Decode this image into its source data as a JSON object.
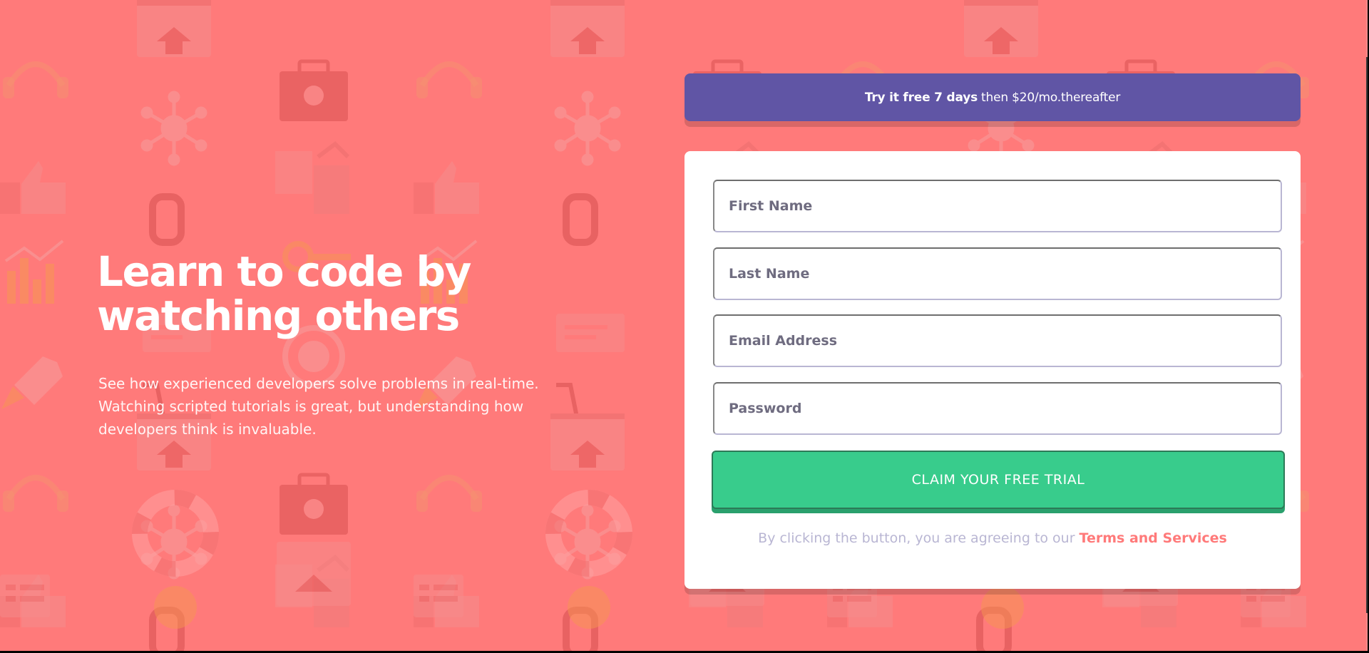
{
  "theme": {
    "background": "#ff7a7a",
    "offer_bg": "#6055a5",
    "cta_bg": "#38cc8c",
    "accent_link": "#ff7a7a",
    "muted_text": "#b9b6d3"
  },
  "hero": {
    "title": "Learn to code by watching others",
    "description": "See how experienced developers solve problems in real-time. Watching scripted tutorials is great, but understanding how developers think is invaluable."
  },
  "offer": {
    "bold": "Try it free 7 days",
    "rest": "then $20/mo.thereafter"
  },
  "form": {
    "fields": [
      {
        "name": "first-name",
        "placeholder": "First Name",
        "value": ""
      },
      {
        "name": "last-name",
        "placeholder": "Last Name",
        "value": ""
      },
      {
        "name": "email",
        "placeholder": "Email Address",
        "value": ""
      },
      {
        "name": "password",
        "placeholder": "Password",
        "value": ""
      }
    ],
    "submit_label": "CLAIM YOUR FREE TRIAL",
    "legal_text": "By clicking the button, you are agreeing to our",
    "legal_link": "Terms and Services"
  },
  "background_icons": [
    "browser-home-icon",
    "headset-icon",
    "toolbox-icon",
    "network-icon",
    "thumbs-up-icon",
    "cube-icon",
    "chain-link-icon",
    "bar-chart-icon",
    "rocket-icon",
    "gear-globe-icon",
    "life-ring-icon",
    "calendar-icon",
    "pencil-note-icon",
    "lightbulb-icon",
    "cart-icon",
    "key-icon"
  ]
}
